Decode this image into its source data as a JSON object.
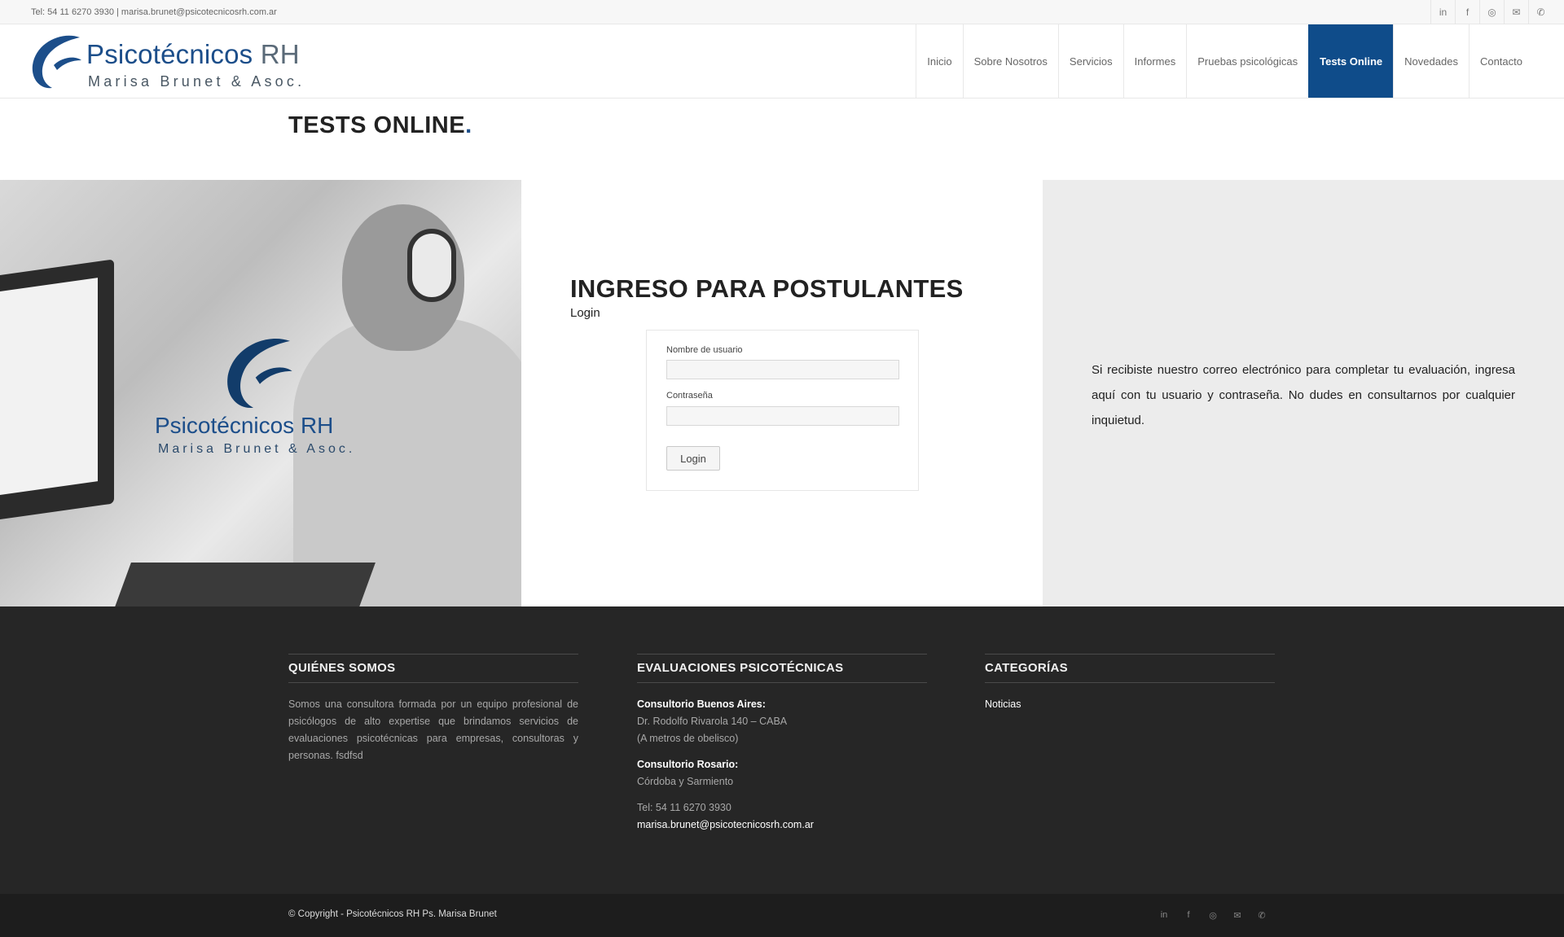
{
  "topbar": {
    "contact": "Tel: 54 11 6270 3930 | marisa.brunet@psicotecnicosrh.com.ar",
    "social": [
      "linkedin-icon",
      "facebook-icon",
      "instagram-icon",
      "mail-icon",
      "whatsapp-icon"
    ],
    "social_glyphs": [
      "in",
      "f",
      "◎",
      "✉",
      "✆"
    ]
  },
  "logo": {
    "line1": "Psicotécnicos",
    "line1_suffix": " RH",
    "line2": "Marisa Brunet & Asoc."
  },
  "nav": [
    {
      "label": "Inicio",
      "active": false
    },
    {
      "label": "Sobre Nosotros",
      "active": false
    },
    {
      "label": "Servicios",
      "active": false
    },
    {
      "label": "Informes",
      "active": false
    },
    {
      "label": "Pruebas psicológicas",
      "active": false
    },
    {
      "label": "Tests Online",
      "active": true
    },
    {
      "label": "Novedades",
      "active": false
    },
    {
      "label": "Contacto",
      "active": false
    }
  ],
  "page": {
    "title": "TESTS ONLINE",
    "title_dot": "."
  },
  "hero": {
    "logo_line1": "Psicotécnicos RH",
    "logo_line2": "Marisa Brunet & Asoc."
  },
  "login": {
    "heading": "INGRESO PARA POSTULANTES",
    "subheading": "Login",
    "username_label": "Nombre de usuario",
    "username_value": "",
    "password_label": "Contraseña",
    "password_value": "",
    "button_label": "Login"
  },
  "info": {
    "text": "Si recibiste nuestro correo electrónico para completar tu evaluación, ingresa aquí con tu usuario y contraseña. No dudes en consultarnos por cualquier inquietud."
  },
  "footer": {
    "about": {
      "heading": "QUIÉNES SOMOS",
      "text": "Somos una consultora formada por un equipo profesional de psicólogos de alto expertise que brindamos servicios de evaluaciones psicotécnicas para empresas, consultoras y personas. fsdfsd"
    },
    "evaluations": {
      "heading": "EVALUACIONES PSICOTÉCNICAS",
      "office1_title": "Consultorio Buenos Aires:",
      "office1_line1": "Dr. Rodolfo Rivarola 140 – CABA",
      "office1_line2": "(A metros de obelisco)",
      "office2_title": "Consultorio Rosario:",
      "office2_line1": "Córdoba y Sarmiento",
      "phone": "Tel: 54 11 6270 3930",
      "email": "marisa.brunet@psicotecnicosrh.com.ar"
    },
    "categories": {
      "heading": "CATEGORÍAS",
      "items": [
        "Noticias"
      ]
    }
  },
  "socket": {
    "copyright": "© Copyright - Psicotécnicos RH Ps. Marisa Brunet"
  },
  "colors": {
    "brand": "#1c4e8a",
    "nav_active": "#0f4c8a",
    "footer_bg": "#262626",
    "socket_bg": "#1d1d1d"
  }
}
